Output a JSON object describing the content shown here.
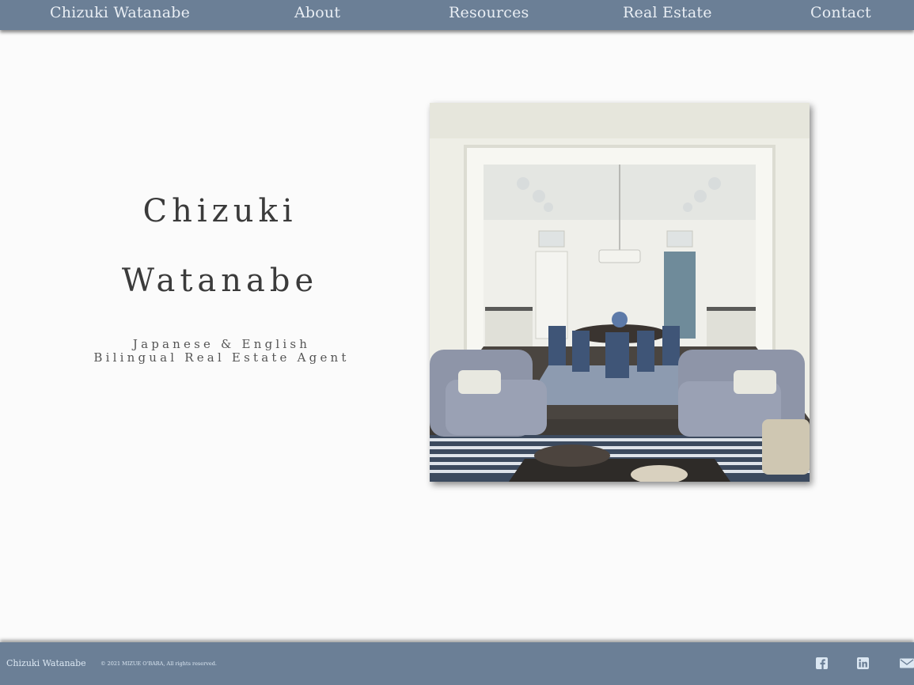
{
  "nav": {
    "brand": "Chizuki Watanabe",
    "items": [
      {
        "label": "About"
      },
      {
        "label": "Resources"
      },
      {
        "label": "Real Estate"
      },
      {
        "label": "Contact"
      }
    ]
  },
  "hero": {
    "name_line1": "Chizuki",
    "name_line2": "Watanabe",
    "subtitle_line1": "Japanese & English",
    "subtitle_line2": "Bilingual Real Estate Agent",
    "image_alt": "Interior of a dining room and kitchen with blue armchairs"
  },
  "footer": {
    "brand": "Chizuki Watanabe",
    "copyright": "© 2021 MIZUE O'BARA, All rights reserved.",
    "social": [
      {
        "icon": "facebook-icon"
      },
      {
        "icon": "linkedin-icon"
      },
      {
        "icon": "mail-icon"
      }
    ]
  },
  "colors": {
    "nav_bg": "#6b7f96",
    "page_bg": "#fbfbfb",
    "nav_text": "#e9eef4"
  }
}
